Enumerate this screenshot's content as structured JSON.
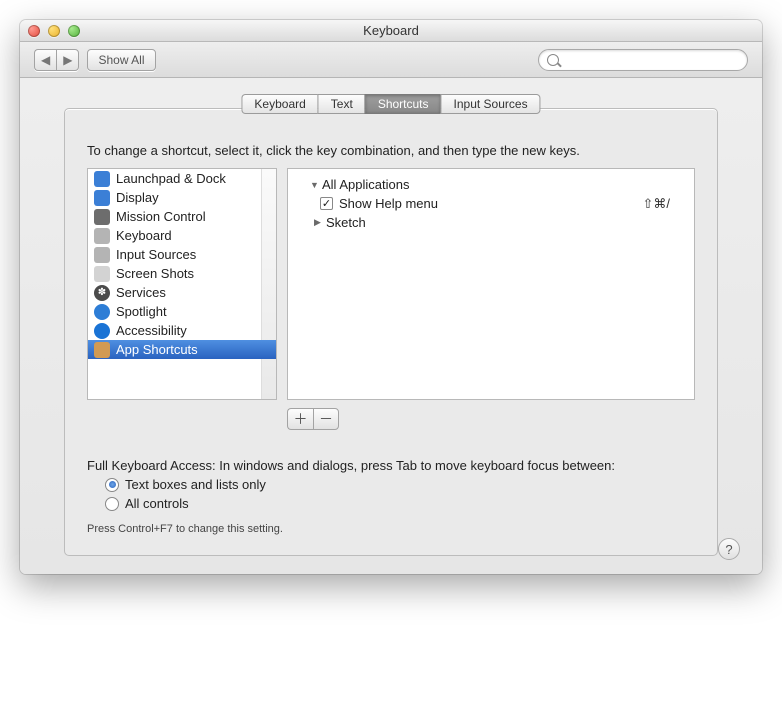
{
  "window": {
    "title": "Keyboard"
  },
  "toolbar": {
    "showAll": "Show All",
    "searchPlaceholder": ""
  },
  "tabs": [
    "Keyboard",
    "Text",
    "Shortcuts",
    "Input Sources"
  ],
  "activeTab": 2,
  "intro": "To change a shortcut, select it, click the key combination, and then type the new keys.",
  "categories": [
    "Launchpad & Dock",
    "Display",
    "Mission Control",
    "Keyboard",
    "Input Sources",
    "Screen Shots",
    "Services",
    "Spotlight",
    "Accessibility",
    "App Shortcuts"
  ],
  "selectedCategory": 9,
  "tree": {
    "root": {
      "label": "All Applications",
      "expanded": true
    },
    "item": {
      "label": "Show Help menu",
      "checked": true,
      "shortcut": "⇧⌘/"
    },
    "group": {
      "label": "Sketch",
      "expanded": false
    }
  },
  "fullKeyboardAccess": {
    "label": "Full Keyboard Access: In windows and dialogs, press Tab to move keyboard focus between:",
    "opt1": "Text boxes and lists only",
    "opt2": "All controls",
    "selected": 0,
    "hint": "Press Control+F7 to change this setting."
  }
}
